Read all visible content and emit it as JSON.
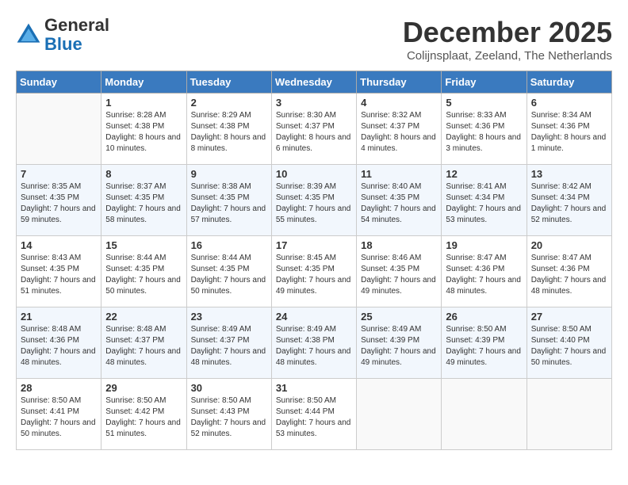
{
  "header": {
    "logo": {
      "line1": "General",
      "line2": "Blue"
    },
    "title": "December 2025",
    "subtitle": "Colijnsplaat, Zeeland, The Netherlands"
  },
  "calendar": {
    "days_of_week": [
      "Sunday",
      "Monday",
      "Tuesday",
      "Wednesday",
      "Thursday",
      "Friday",
      "Saturday"
    ],
    "weeks": [
      [
        {
          "day": "",
          "sunrise": "",
          "sunset": "",
          "daylight": ""
        },
        {
          "day": "1",
          "sunrise": "Sunrise: 8:28 AM",
          "sunset": "Sunset: 4:38 PM",
          "daylight": "Daylight: 8 hours and 10 minutes."
        },
        {
          "day": "2",
          "sunrise": "Sunrise: 8:29 AM",
          "sunset": "Sunset: 4:38 PM",
          "daylight": "Daylight: 8 hours and 8 minutes."
        },
        {
          "day": "3",
          "sunrise": "Sunrise: 8:30 AM",
          "sunset": "Sunset: 4:37 PM",
          "daylight": "Daylight: 8 hours and 6 minutes."
        },
        {
          "day": "4",
          "sunrise": "Sunrise: 8:32 AM",
          "sunset": "Sunset: 4:37 PM",
          "daylight": "Daylight: 8 hours and 4 minutes."
        },
        {
          "day": "5",
          "sunrise": "Sunrise: 8:33 AM",
          "sunset": "Sunset: 4:36 PM",
          "daylight": "Daylight: 8 hours and 3 minutes."
        },
        {
          "day": "6",
          "sunrise": "Sunrise: 8:34 AM",
          "sunset": "Sunset: 4:36 PM",
          "daylight": "Daylight: 8 hours and 1 minute."
        }
      ],
      [
        {
          "day": "7",
          "sunrise": "Sunrise: 8:35 AM",
          "sunset": "Sunset: 4:35 PM",
          "daylight": "Daylight: 7 hours and 59 minutes."
        },
        {
          "day": "8",
          "sunrise": "Sunrise: 8:37 AM",
          "sunset": "Sunset: 4:35 PM",
          "daylight": "Daylight: 7 hours and 58 minutes."
        },
        {
          "day": "9",
          "sunrise": "Sunrise: 8:38 AM",
          "sunset": "Sunset: 4:35 PM",
          "daylight": "Daylight: 7 hours and 57 minutes."
        },
        {
          "day": "10",
          "sunrise": "Sunrise: 8:39 AM",
          "sunset": "Sunset: 4:35 PM",
          "daylight": "Daylight: 7 hours and 55 minutes."
        },
        {
          "day": "11",
          "sunrise": "Sunrise: 8:40 AM",
          "sunset": "Sunset: 4:35 PM",
          "daylight": "Daylight: 7 hours and 54 minutes."
        },
        {
          "day": "12",
          "sunrise": "Sunrise: 8:41 AM",
          "sunset": "Sunset: 4:34 PM",
          "daylight": "Daylight: 7 hours and 53 minutes."
        },
        {
          "day": "13",
          "sunrise": "Sunrise: 8:42 AM",
          "sunset": "Sunset: 4:34 PM",
          "daylight": "Daylight: 7 hours and 52 minutes."
        }
      ],
      [
        {
          "day": "14",
          "sunrise": "Sunrise: 8:43 AM",
          "sunset": "Sunset: 4:35 PM",
          "daylight": "Daylight: 7 hours and 51 minutes."
        },
        {
          "day": "15",
          "sunrise": "Sunrise: 8:44 AM",
          "sunset": "Sunset: 4:35 PM",
          "daylight": "Daylight: 7 hours and 50 minutes."
        },
        {
          "day": "16",
          "sunrise": "Sunrise: 8:44 AM",
          "sunset": "Sunset: 4:35 PM",
          "daylight": "Daylight: 7 hours and 50 minutes."
        },
        {
          "day": "17",
          "sunrise": "Sunrise: 8:45 AM",
          "sunset": "Sunset: 4:35 PM",
          "daylight": "Daylight: 7 hours and 49 minutes."
        },
        {
          "day": "18",
          "sunrise": "Sunrise: 8:46 AM",
          "sunset": "Sunset: 4:35 PM",
          "daylight": "Daylight: 7 hours and 49 minutes."
        },
        {
          "day": "19",
          "sunrise": "Sunrise: 8:47 AM",
          "sunset": "Sunset: 4:36 PM",
          "daylight": "Daylight: 7 hours and 48 minutes."
        },
        {
          "day": "20",
          "sunrise": "Sunrise: 8:47 AM",
          "sunset": "Sunset: 4:36 PM",
          "daylight": "Daylight: 7 hours and 48 minutes."
        }
      ],
      [
        {
          "day": "21",
          "sunrise": "Sunrise: 8:48 AM",
          "sunset": "Sunset: 4:36 PM",
          "daylight": "Daylight: 7 hours and 48 minutes."
        },
        {
          "day": "22",
          "sunrise": "Sunrise: 8:48 AM",
          "sunset": "Sunset: 4:37 PM",
          "daylight": "Daylight: 7 hours and 48 minutes."
        },
        {
          "day": "23",
          "sunrise": "Sunrise: 8:49 AM",
          "sunset": "Sunset: 4:37 PM",
          "daylight": "Daylight: 7 hours and 48 minutes."
        },
        {
          "day": "24",
          "sunrise": "Sunrise: 8:49 AM",
          "sunset": "Sunset: 4:38 PM",
          "daylight": "Daylight: 7 hours and 48 minutes."
        },
        {
          "day": "25",
          "sunrise": "Sunrise: 8:49 AM",
          "sunset": "Sunset: 4:39 PM",
          "daylight": "Daylight: 7 hours and 49 minutes."
        },
        {
          "day": "26",
          "sunrise": "Sunrise: 8:50 AM",
          "sunset": "Sunset: 4:39 PM",
          "daylight": "Daylight: 7 hours and 49 minutes."
        },
        {
          "day": "27",
          "sunrise": "Sunrise: 8:50 AM",
          "sunset": "Sunset: 4:40 PM",
          "daylight": "Daylight: 7 hours and 50 minutes."
        }
      ],
      [
        {
          "day": "28",
          "sunrise": "Sunrise: 8:50 AM",
          "sunset": "Sunset: 4:41 PM",
          "daylight": "Daylight: 7 hours and 50 minutes."
        },
        {
          "day": "29",
          "sunrise": "Sunrise: 8:50 AM",
          "sunset": "Sunset: 4:42 PM",
          "daylight": "Daylight: 7 hours and 51 minutes."
        },
        {
          "day": "30",
          "sunrise": "Sunrise: 8:50 AM",
          "sunset": "Sunset: 4:43 PM",
          "daylight": "Daylight: 7 hours and 52 minutes."
        },
        {
          "day": "31",
          "sunrise": "Sunrise: 8:50 AM",
          "sunset": "Sunset: 4:44 PM",
          "daylight": "Daylight: 7 hours and 53 minutes."
        },
        {
          "day": "",
          "sunrise": "",
          "sunset": "",
          "daylight": ""
        },
        {
          "day": "",
          "sunrise": "",
          "sunset": "",
          "daylight": ""
        },
        {
          "day": "",
          "sunrise": "",
          "sunset": "",
          "daylight": ""
        }
      ]
    ]
  }
}
